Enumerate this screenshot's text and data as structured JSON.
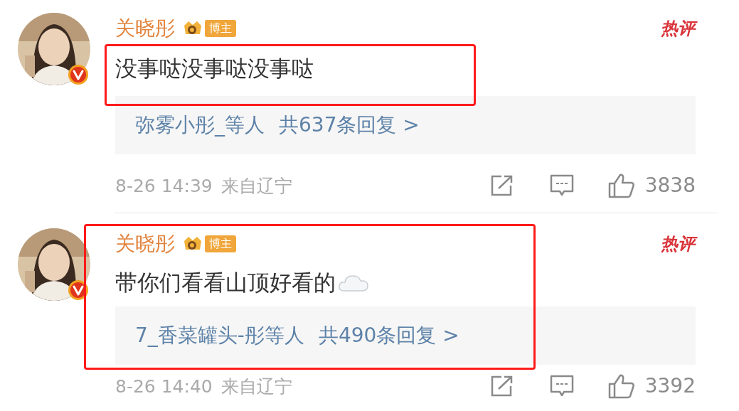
{
  "comments": [
    {
      "author": "关晓彤",
      "badge": "博主",
      "hot_tag": "热评",
      "text": "没事哒没事哒没事哒",
      "replies": {
        "users": "弥雾小彤_等人",
        "count": "共637条回复 >"
      },
      "time": "8-26 14:39",
      "location": "来自辽宁",
      "likes": "3838",
      "highlighted": true,
      "emoji": false
    },
    {
      "author": "关晓彤",
      "badge": "博主",
      "hot_tag": "热评",
      "text": "带你们看看山顶好看的",
      "replies": {
        "users": "7_香菜罐头-彤等人",
        "count": "共490条回复 >"
      },
      "time": "8-26 14:40",
      "location": "来自辽宁",
      "likes": "3392",
      "highlighted": true,
      "emoji": true
    }
  ]
}
